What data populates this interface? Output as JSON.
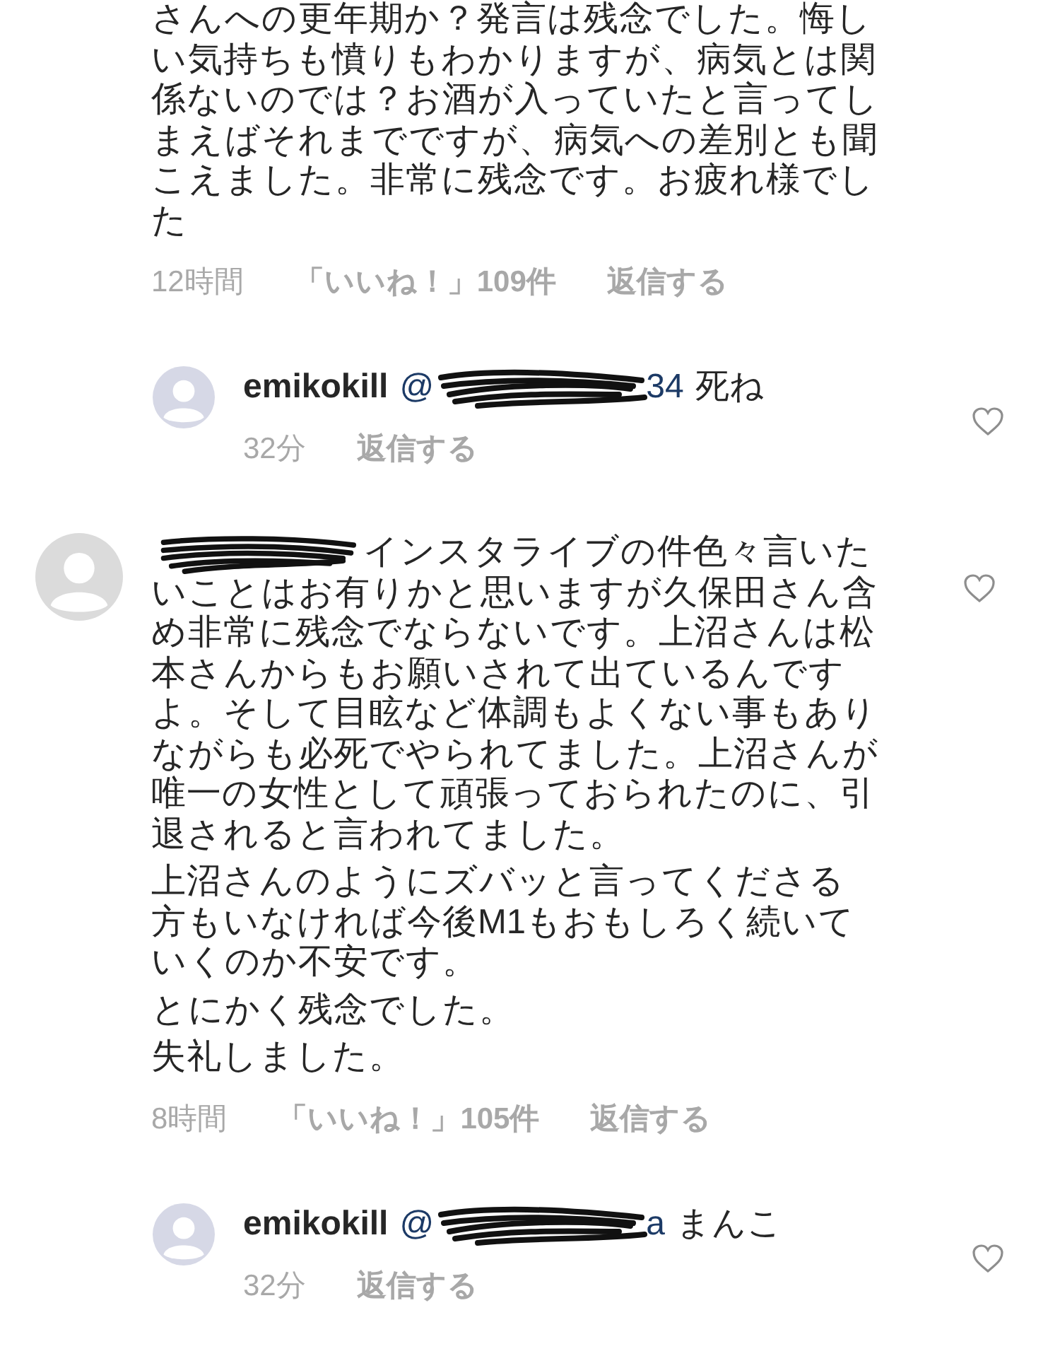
{
  "items": [
    {
      "kind": "continued",
      "body": [
        "さんへの更年期か？発言は残念でした。悔しい気持ちも憤りもわかりますが、病気とは関係ないのでは？お酒が入っていたと言ってしまえばそれまでですが、病気への差別とも聞こえました。非常に残念です。お疲れ様でした"
      ],
      "time": "12時間",
      "likes": "「いいね！」109件",
      "reply": "返信する"
    },
    {
      "kind": "reply",
      "username": "emikokill",
      "mention": {
        "prefix": "@",
        "suffix": "34"
      },
      "text": "死ね",
      "time": "32分",
      "reply": "返信する",
      "liked": false
    },
    {
      "kind": "comment",
      "author_redacted": true,
      "body": [
        "インスタライブの件色々言いたいことはお有りかと思いますが久保田さん含め非常に残念でならないです。上沼さんは松本さんからもお願いされて出ているんですよ。そして目眩など体調もよくない事もありながらも必死でやられてました。上沼さんが唯一の女性として頑張っておられたのに、引退されると言われてました。",
        "上沼さんのようにズバッと言ってくださる方もいなければ今後M1もおもしろく続いていくのか不安です。",
        "とにかく残念でした。",
        "失礼しました。"
      ],
      "time": "8時間",
      "likes": "「いいね！」105件",
      "reply": "返信する",
      "liked": false
    },
    {
      "kind": "reply",
      "username": "emikokill",
      "mention": {
        "prefix": "@",
        "suffix": "a"
      },
      "text": "まんこ",
      "time": "32分",
      "reply": "返信する",
      "liked": false
    }
  ]
}
